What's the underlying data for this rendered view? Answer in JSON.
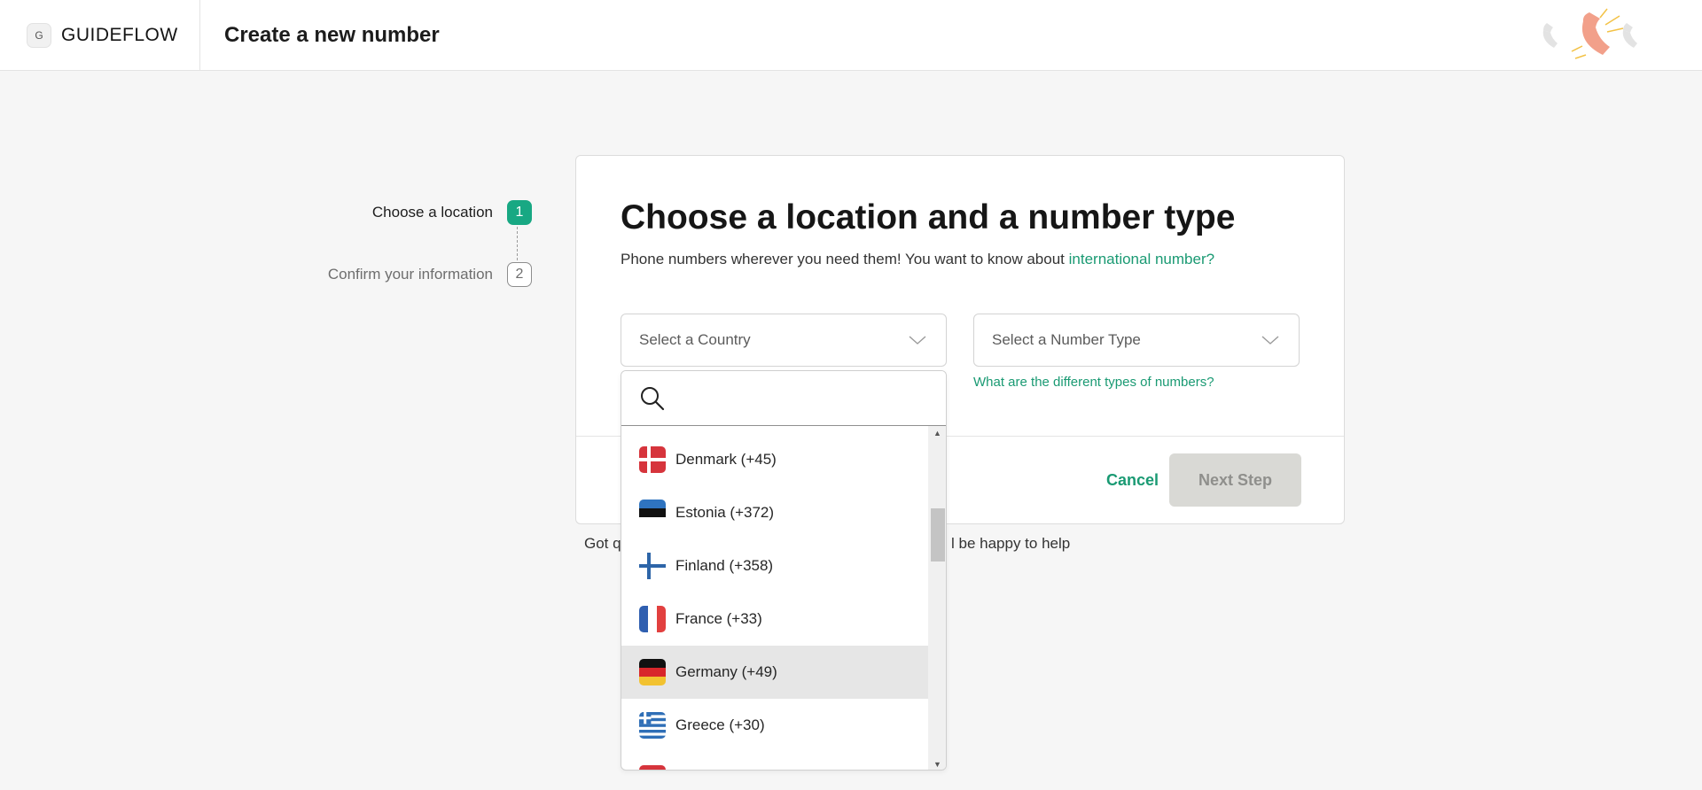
{
  "header": {
    "brand_badge": "G",
    "brand_name": "GUIDEFLOW",
    "page_title": "Create a new number"
  },
  "stepper": [
    {
      "label": "Choose a location",
      "number": "1"
    },
    {
      "label": "Confirm your information",
      "number": "2"
    }
  ],
  "card": {
    "title": "Choose a location and a number type",
    "subtitle": "Phone numbers wherever you need them! You want to know about",
    "subtitle_link": "international number?",
    "country_select": {
      "placeholder": "Select a Country"
    },
    "type_select": {
      "placeholder": "Select a Number Type"
    },
    "types_link": "What are the different types of numbers?",
    "cancel_label": "Cancel",
    "next_label": "Next Step"
  },
  "help": {
    "left_text": "Got q",
    "right_text": "l be happy to help"
  },
  "dropdown": {
    "search_value": "",
    "countries": [
      {
        "label": "Denmark (+45)",
        "flag": "denmark-flag-icon",
        "highlighted": false
      },
      {
        "label": "Estonia (+372)",
        "flag": "estonia-flag-icon",
        "highlighted": false
      },
      {
        "label": "Finland (+358)",
        "flag": "finland-flag-icon",
        "highlighted": false
      },
      {
        "label": "France (+33)",
        "flag": "france-flag-icon",
        "highlighted": false
      },
      {
        "label": "Germany (+49)",
        "flag": "germany-flag-icon",
        "highlighted": true
      },
      {
        "label": "Greece (+30)",
        "flag": "greece-flag-icon",
        "highlighted": false
      }
    ]
  },
  "colors": {
    "accent": "#18a883",
    "link": "#1a9a73",
    "background": "#f6f6f6",
    "disabled_button": "#d9d9d5"
  }
}
